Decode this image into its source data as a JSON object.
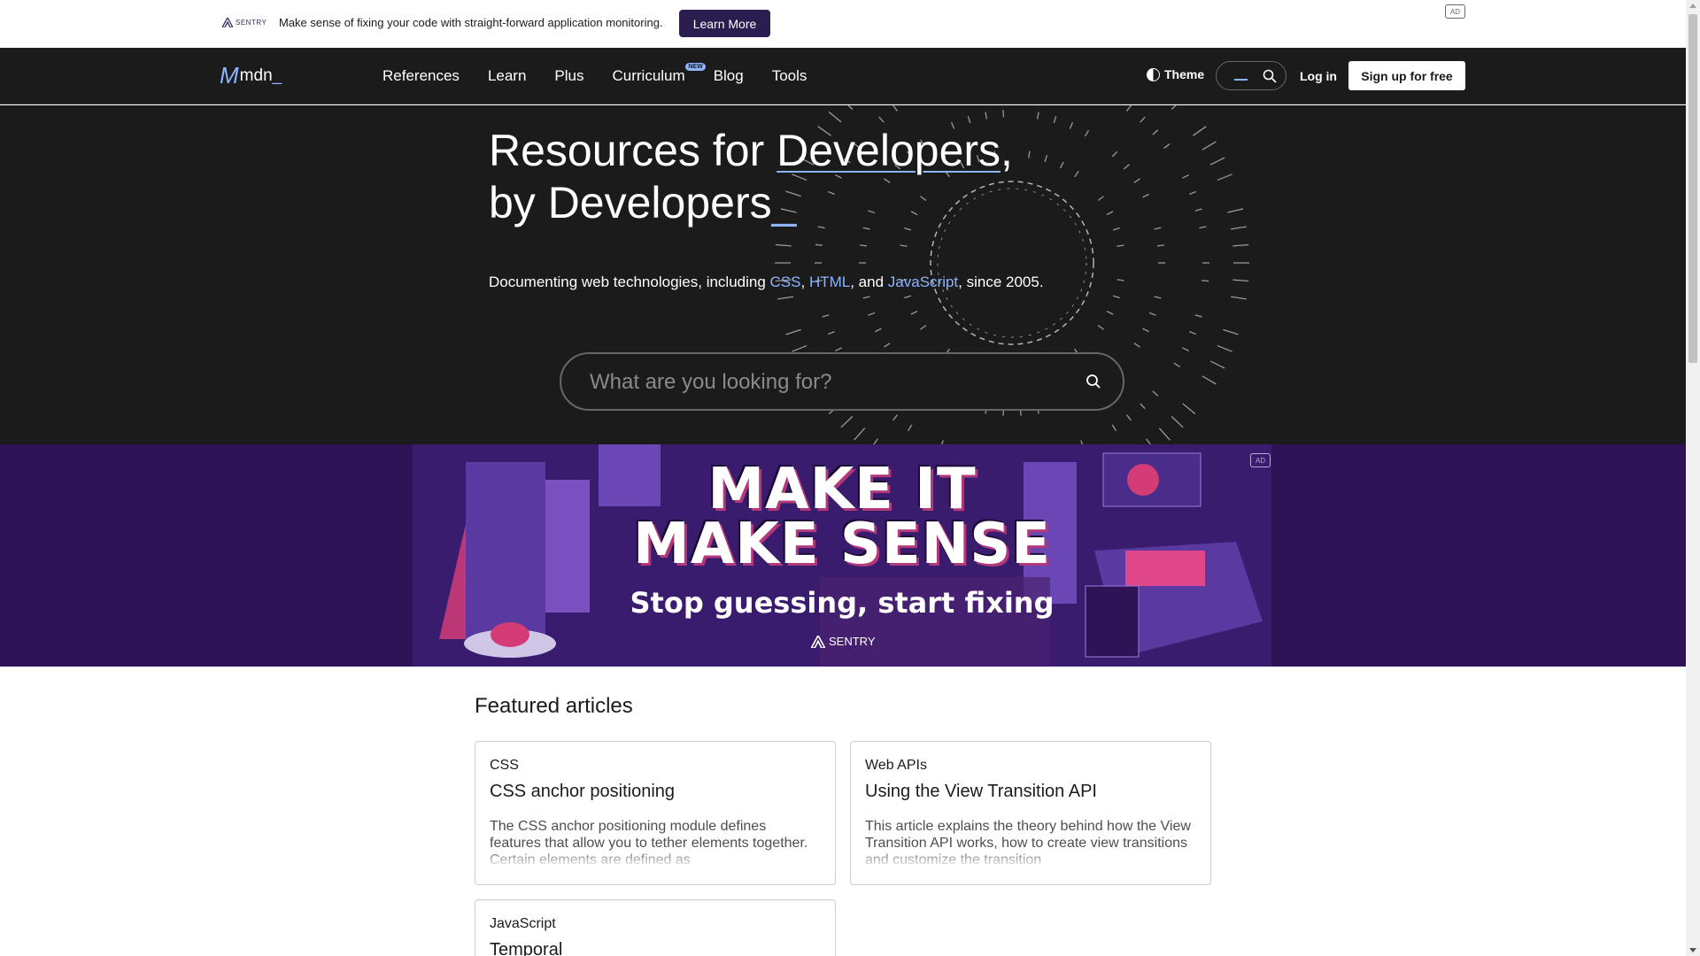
{
  "top_ad": {
    "sponsor_logo": "SENTRY",
    "text": "Make sense of fixing your code with straight-forward application monitoring.",
    "cta": "Learn More",
    "ad_badge": "AD"
  },
  "header": {
    "logo_mark": "M",
    "logo_text": "mdn",
    "logo_cursor": "_",
    "nav": [
      {
        "label": "References"
      },
      {
        "label": "Learn"
      },
      {
        "label": "Plus"
      },
      {
        "label": "Curriculum",
        "badge": "NEW"
      },
      {
        "label": "Blog"
      },
      {
        "label": "Tools"
      }
    ],
    "theme_label": "Theme",
    "login_label": "Log in",
    "signup_label": "Sign up for free"
  },
  "hero": {
    "title_part1": "Resources for ",
    "title_highlight": "Developers",
    "title_part2": ",",
    "title_line2": "by Developers",
    "title_cursor": "_",
    "sub_prefix": "Documenting web technologies, including ",
    "sub_link1": "CSS",
    "sub_sep1": ", ",
    "sub_link2": "HTML",
    "sub_sep2": ", and ",
    "sub_link3": "JavaScript",
    "sub_suffix": ", since 2005.",
    "search_placeholder": "What are you looking for?"
  },
  "banner_ad": {
    "line1": "MAKE IT",
    "line2": "MAKE SENSE",
    "subtitle": "Stop guessing, start fixing",
    "sponsor": "SENTRY",
    "ad_badge": "AD"
  },
  "featured": {
    "heading": "Featured articles",
    "articles": [
      {
        "category": "CSS",
        "title": "CSS anchor positioning",
        "description": "The CSS anchor positioning module defines features that allow you to tether elements together. Certain elements are defined as"
      },
      {
        "category": "Web APIs",
        "title": "Using the View Transition API",
        "description": "This article explains the theory behind how the View Transition API works, how to create view transitions and customize the transition"
      },
      {
        "category": "JavaScript",
        "title": "Temporal",
        "description": ""
      }
    ]
  },
  "colors": {
    "accent": "#8cb4ff",
    "dark_bg": "#1b1b1b",
    "ad_purple": "#2e1456",
    "cta_bg": "#2b1d4f"
  }
}
